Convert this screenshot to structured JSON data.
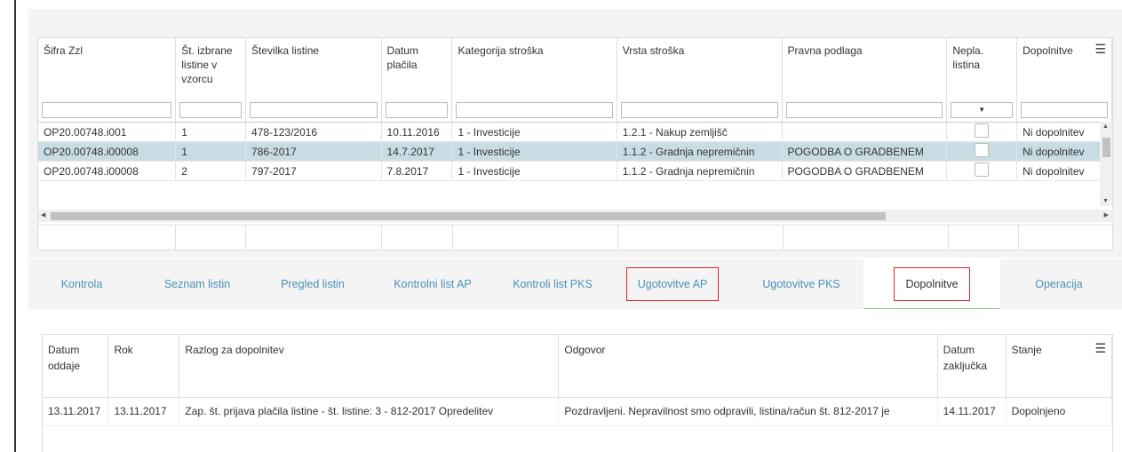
{
  "top_grid": {
    "columns": [
      "Šifra Zzl",
      "Št. izbrane listine v vzorcu",
      "Številka listine",
      "Datum plačila",
      "Kategorija stroška",
      "Vrsta stroška",
      "Pravna podlaga",
      "Nepla. listina",
      "Dopolnitve"
    ],
    "rows": [
      {
        "sifra": "OP20.00748.i001",
        "st": "1",
        "stevilka": "478-123/2016",
        "datum": "10.11.2016",
        "kategorija": "1 - Investicije",
        "vrsta": "1.2.1 - Nakup zemljišč",
        "podlaga": "",
        "dopolnitve": "Ni dopolnitev"
      },
      {
        "sifra": "OP20.00748.i00008",
        "st": "1",
        "stevilka": "786-2017",
        "datum": "14.7.2017",
        "kategorija": "1 - Investicije",
        "vrsta": "1.1.2 - Gradnja nepremičnin",
        "podlaga": "POGODBA O GRADBENEM",
        "dopolnitve": "Ni dopolnitev"
      },
      {
        "sifra": "OP20.00748.i00008",
        "st": "2",
        "stevilka": "797-2017",
        "datum": "7.8.2017",
        "kategorija": "1 - Investicije",
        "vrsta": "1.1.2 - Gradnja nepremičnin",
        "podlaga": "POGODBA O GRADBENEM",
        "dopolnitve": "Ni dopolnitev"
      }
    ]
  },
  "tabs": [
    "Kontrola",
    "Seznam listin",
    "Pregled listin",
    "Kontrolni list AP",
    "Kontroli list PKS",
    "Ugotovitve AP",
    "Ugotovitve PKS",
    "Dopolnitve",
    "Operacija"
  ],
  "bottom_grid": {
    "columns": [
      "Datum oddaje",
      "Rok",
      "Razlog za dopolnitev",
      "Odgovor",
      "Datum zaključka",
      "Stanje"
    ],
    "rows": [
      {
        "oddaje": "13.11.2017",
        "rok": "13.11.2017",
        "razlog": "Zap. št. prijava plačila listine - št. listine: 3 - 812-2017 Opredelitev",
        "odgovor": "Pozdravljeni. Nepravilnost smo odpravili, listina/račun št. 812-2017 je",
        "zakljucka": "14.11.2017",
        "stanje": "Dopolnjeno"
      }
    ]
  },
  "icons": {
    "menu": "hamburger-menu-icon",
    "dropdown": "dropdown-arrow-icon"
  },
  "colors": {
    "selected_row": "#c8dde3",
    "tab_link": "#4b90b8",
    "highlight_box": "#d9262b"
  }
}
